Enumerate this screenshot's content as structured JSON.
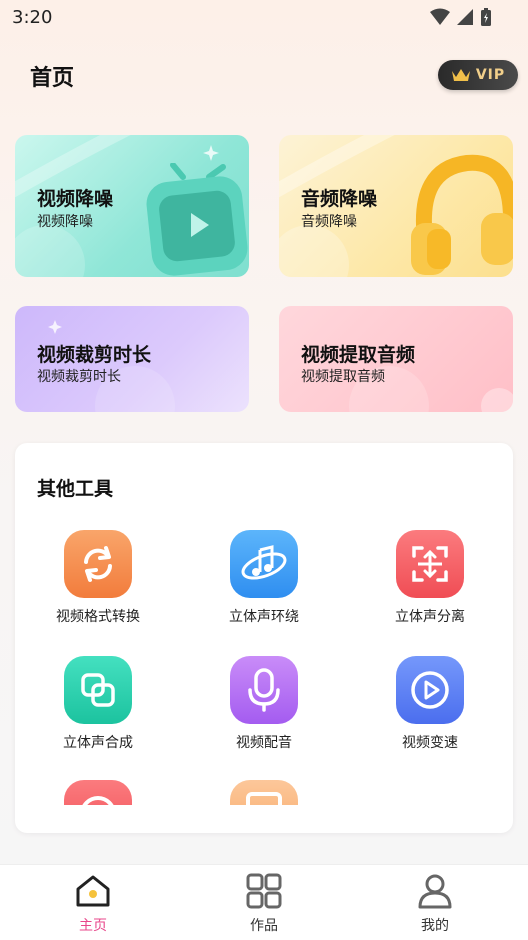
{
  "status_bar": {
    "time": "3:20"
  },
  "header": {
    "title": "首页",
    "vip_label": "VIP"
  },
  "feature_cards": [
    {
      "title": "视频降噪",
      "subtitle": "视频降噪"
    },
    {
      "title": "音频降噪",
      "subtitle": "音频降噪"
    },
    {
      "title": "视频裁剪时长",
      "subtitle": "视频裁剪时长"
    },
    {
      "title": "视频提取音频",
      "subtitle": "视频提取音频"
    }
  ],
  "tools": {
    "title": "其他工具",
    "items": [
      {
        "label": "视频格式转换",
        "icon": "convert-icon",
        "color": "#f58b4f"
      },
      {
        "label": "立体声环绕",
        "icon": "music-surround-icon",
        "color": "#3b9bf0"
      },
      {
        "label": "立体声分离",
        "icon": "split-icon",
        "color": "#f45a5f"
      },
      {
        "label": "立体声合成",
        "icon": "merge-icon",
        "color": "#26d1ad"
      },
      {
        "label": "视频配音",
        "icon": "microphone-icon",
        "color": "#b46af3"
      },
      {
        "label": "视频变速",
        "icon": "play-speed-icon",
        "color": "#5b7ff0"
      }
    ]
  },
  "bottom_nav": {
    "items": [
      {
        "label": "主页",
        "icon": "home-icon",
        "active": true
      },
      {
        "label": "作品",
        "icon": "grid-icon",
        "active": false
      },
      {
        "label": "我的",
        "icon": "profile-icon",
        "active": false
      }
    ]
  },
  "colors": {
    "active_tab": "#e8478b",
    "vip_text": "#f1cf8a"
  }
}
